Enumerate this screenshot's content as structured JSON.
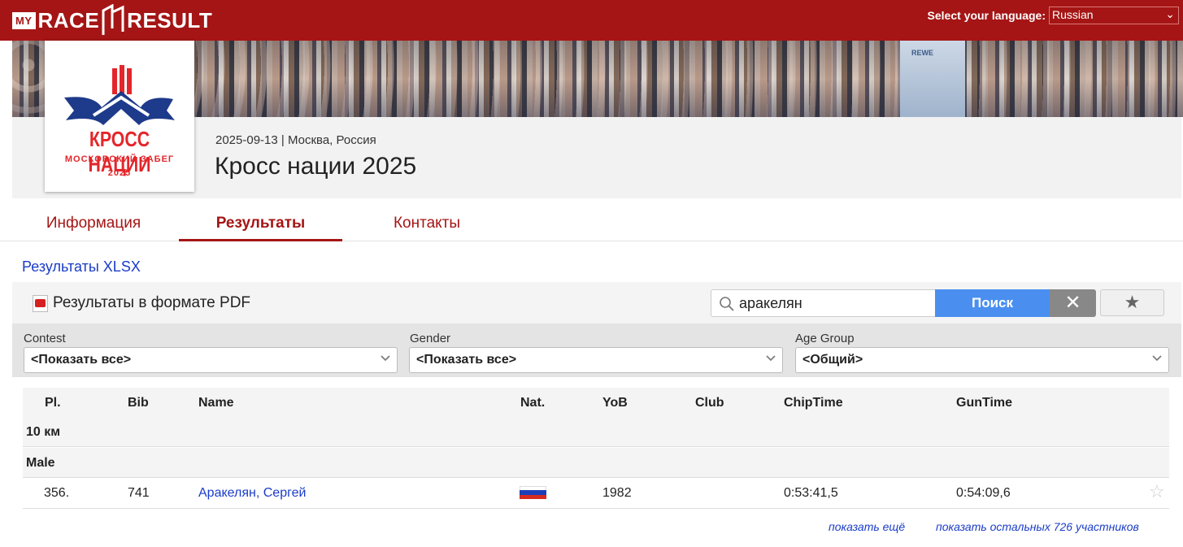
{
  "brand": {
    "my": "MY",
    "race": "RACE",
    "result": "RESULT"
  },
  "language": {
    "label": "Select your language:",
    "selected": "Russian"
  },
  "event": {
    "logo_title": "КРОСС НАЦИИ",
    "logo_subtitle": "МОСКОВСКИЙ ЗАБЕГ",
    "logo_year": "2025",
    "date_location": "2025-09-13 | Москва, Россия",
    "title": "Кросс нации 2025"
  },
  "tabs": [
    {
      "label": "Информация",
      "active": false
    },
    {
      "label": "Результаты",
      "active": true
    },
    {
      "label": "Контакты",
      "active": false
    }
  ],
  "links": {
    "xlsx": "Результаты XLSX",
    "pdf": "Результаты в формате PDF"
  },
  "search": {
    "value": "аракелян",
    "button": "Поиск",
    "clear": "✕",
    "favorite": "★"
  },
  "filters": [
    {
      "label": "Contest",
      "value": "<Показать все>"
    },
    {
      "label": "Gender",
      "value": "<Показать все>"
    },
    {
      "label": "Age Group",
      "value": "<Общий>"
    }
  ],
  "table": {
    "columns": [
      "Pl.",
      "Bib",
      "Name",
      "Nat.",
      "YoB",
      "Club",
      "ChipTime",
      "GunTime"
    ],
    "contest": "10 км",
    "gender_group": "Male",
    "rows": [
      {
        "place": "356.",
        "bib": "741",
        "name": "Аракелян, Сергей",
        "nat": "RUS",
        "yob": "1982",
        "club": "",
        "chiptime": "0:53:41,5",
        "guntime": "0:54:09,6"
      }
    ]
  },
  "footer_links": {
    "show_more": "показать ещё",
    "show_rest": "показать остальных 726 участников"
  },
  "colors": {
    "brand_red": "#a51515",
    "link_blue": "#1a3cc8",
    "button_blue": "#4a8ff0"
  }
}
